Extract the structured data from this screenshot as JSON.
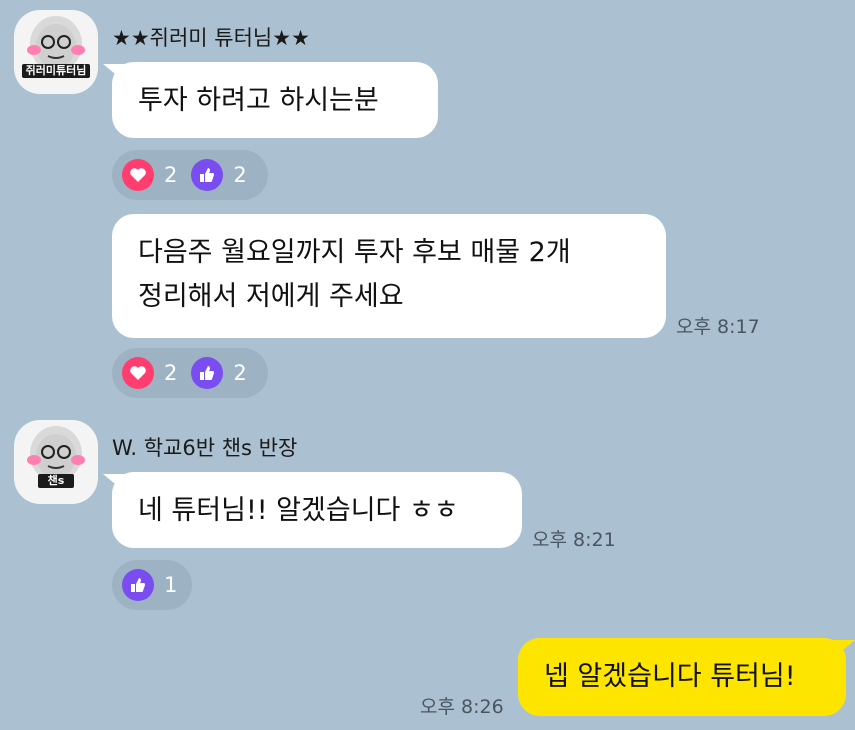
{
  "colors": {
    "background": "#abc1d1",
    "my_bubble": "#fee500",
    "heart": "#ff3d6e",
    "like": "#7a4df0"
  },
  "sender1": {
    "name": "★★쥐러미 튜터님★★",
    "avatar_caption": "쥐러미튜터님",
    "messages": [
      {
        "text": "투자 하려고 하시는분",
        "reactions": {
          "heart": "2",
          "like": "2"
        }
      },
      {
        "lines": [
          "다음주 월요일까지 투자 후보 매물 2개",
          "정리해서 저에게 주세요"
        ],
        "time": "오후 8:17",
        "reactions": {
          "heart": "2",
          "like": "2"
        }
      }
    ]
  },
  "sender2": {
    "name": "W. 학교6반 챈s 반장",
    "avatar_caption": "챈s",
    "messages": [
      {
        "text": "네 튜터님!! 알겠습니다 ㅎㅎ",
        "time": "오후 8:21",
        "reactions": {
          "like": "1"
        }
      }
    ]
  },
  "mine": {
    "text": "넵 알겠습니다 튜터님!",
    "time": "오후 8:26"
  }
}
